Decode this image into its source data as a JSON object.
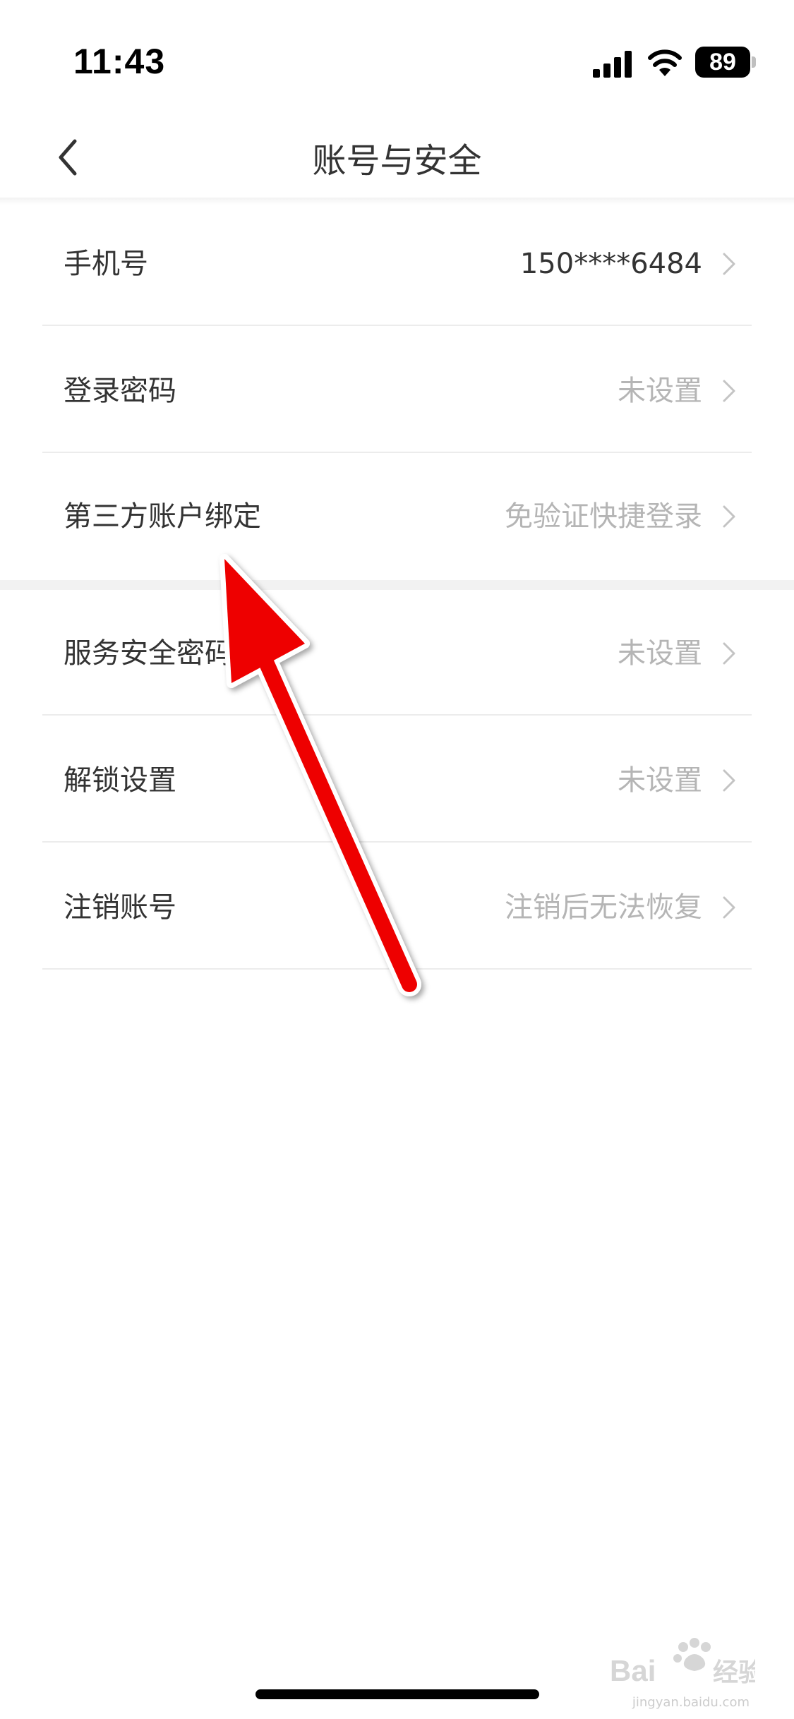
{
  "status_bar": {
    "time": "11:43",
    "battery": "89",
    "icons": [
      "signal-icon",
      "wifi-icon",
      "battery-icon"
    ]
  },
  "nav": {
    "title": "账号与安全",
    "back_icon": "chevron-left-icon"
  },
  "rows": [
    {
      "label": "手机号",
      "value": "150****6484"
    },
    {
      "label": "登录密码",
      "value": "未设置"
    },
    {
      "label": "第三方账户绑定",
      "value": "免验证快捷登录"
    },
    {
      "label": "服务安全密码",
      "value": "未设置"
    },
    {
      "label": "解锁设置",
      "value": "未设置"
    },
    {
      "label": "注销账号",
      "value": "注销后无法恢复"
    }
  ],
  "annotation": {
    "color": "#ee0000"
  },
  "watermark": {
    "logo": "Baidu经验",
    "url": "jingyan.baidu.com"
  },
  "colors": {
    "text_primary": "#333333",
    "text_secondary": "#b5b5b5",
    "divider": "#ececec",
    "section_gap": "#f2f2f2"
  }
}
